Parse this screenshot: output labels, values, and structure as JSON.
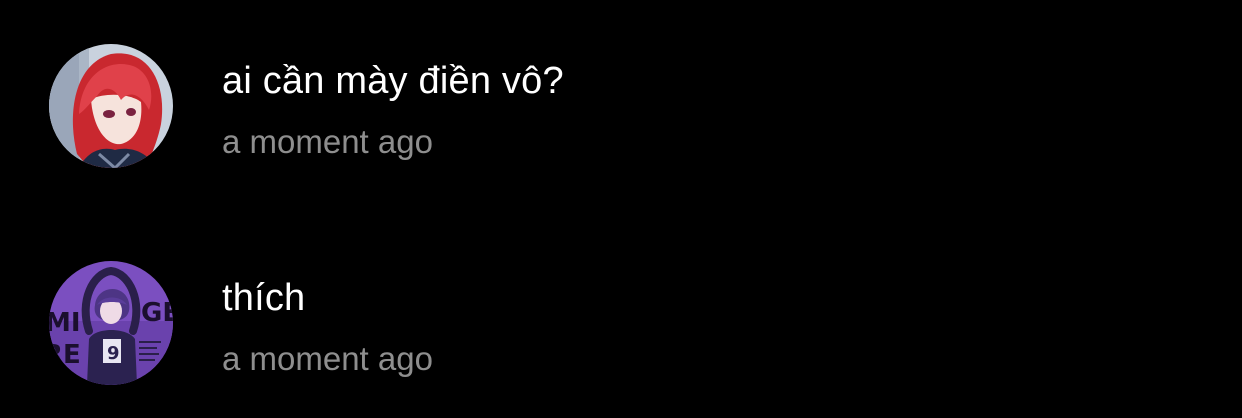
{
  "comments": [
    {
      "avatar_icon": "user-avatar-red-hair",
      "text": "ai cần mày điền vô?",
      "time": "a moment ago"
    },
    {
      "avatar_icon": "user-avatar-purple-hair",
      "avatar_lettering": "MI GE RE",
      "text": "thích",
      "time": "a moment ago"
    }
  ],
  "colors": {
    "background": "#000000",
    "text": "#ffffff",
    "secondary_text": "#8e8e8e",
    "avatar1_hair": "#d9353b",
    "avatar2_bg": "#7b4fc0"
  }
}
